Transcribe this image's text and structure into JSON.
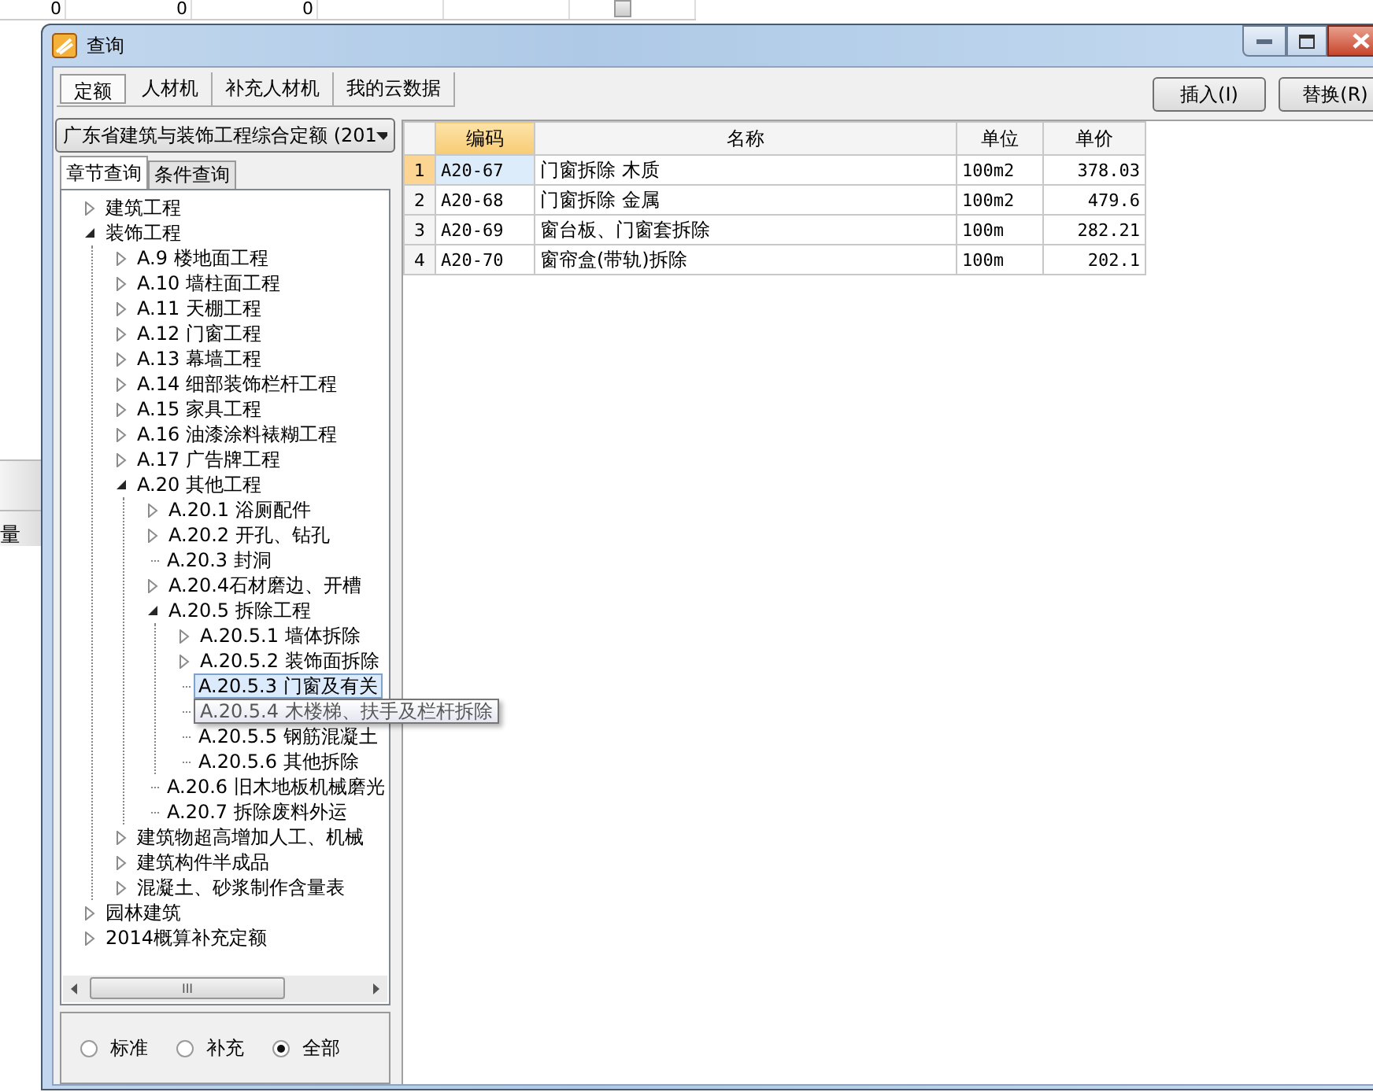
{
  "background_sheet": {
    "row_1": [
      "0",
      "0",
      "0"
    ],
    "checkbox": {
      "checked": false
    },
    "side_cell": "量"
  },
  "window": {
    "title": "查询",
    "tabs": [
      {
        "label": "定额",
        "selected": true
      },
      {
        "label": "人材机",
        "selected": false
      },
      {
        "label": "补充人材机",
        "selected": false
      },
      {
        "label": "我的云数据",
        "selected": false
      }
    ],
    "buttons": [
      "插入(I)",
      "替换(R)"
    ]
  },
  "left_panel": {
    "library_select": "广东省建筑与装饰工程综合定额 (201",
    "tabs": [
      {
        "label": "章节查询",
        "selected": true
      },
      {
        "label": "条件查询",
        "selected": false
      }
    ],
    "tree": [
      {
        "label": "建筑工程",
        "expanded": false,
        "selected": false
      },
      {
        "label": "装饰工程",
        "expanded": true,
        "selected": false,
        "children": [
          {
            "label": "A.9 楼地面工程",
            "expanded": false,
            "selected": false
          },
          {
            "label": "A.10 墙柱面工程",
            "expanded": false,
            "selected": false
          },
          {
            "label": "A.11 天棚工程",
            "expanded": false,
            "selected": false
          },
          {
            "label": "A.12 门窗工程",
            "expanded": false,
            "selected": false
          },
          {
            "label": "A.13 幕墙工程",
            "expanded": false,
            "selected": false
          },
          {
            "label": "A.14 细部装饰栏杆工程",
            "expanded": false,
            "selected": false
          },
          {
            "label": "A.15 家具工程",
            "expanded": false,
            "selected": false
          },
          {
            "label": "A.16 油漆涂料裱糊工程",
            "expanded": false,
            "selected": false
          },
          {
            "label": "A.17 广告牌工程",
            "expanded": false,
            "selected": false
          },
          {
            "label": "A.20 其他工程",
            "expanded": true,
            "selected": false,
            "children": [
              {
                "label": "A.20.1 浴厕配件",
                "expanded": false,
                "selected": false
              },
              {
                "label": "A.20.2 开孔、钻孔",
                "expanded": false,
                "selected": false
              },
              {
                "label": "A.20.3 封洞",
                "selected": false
              },
              {
                "label": "A.20.4石材磨边、开槽",
                "expanded": false,
                "selected": false
              },
              {
                "label": "A.20.5 拆除工程",
                "expanded": true,
                "selected": false,
                "children": [
                  {
                    "label": "A.20.5.1 墙体拆除",
                    "expanded": false,
                    "selected": false
                  },
                  {
                    "label": "A.20.5.2 装饰面拆除",
                    "expanded": false,
                    "selected": false
                  },
                  {
                    "label": "A.20.5.3 门窗及有关",
                    "selected": true
                  },
                  {
                    "label": "A.20.5.4 木楼梯、扶手及栏杆拆除",
                    "selected": false,
                    "hovered": true
                  },
                  {
                    "label": "A.20.5.5 钢筋混凝土",
                    "selected": false
                  },
                  {
                    "label": "A.20.5.6 其他拆除",
                    "selected": false
                  }
                ]
              },
              {
                "label": "A.20.6 旧木地板机械磨光",
                "selected": false
              },
              {
                "label": "A.20.7 拆除废料外运",
                "selected": false
              }
            ]
          },
          {
            "label": "建筑物超高增加人工、机械",
            "expanded": false,
            "selected": false
          },
          {
            "label": "建筑构件半成品",
            "expanded": false,
            "selected": false
          },
          {
            "label": "混凝土、砂浆制作含量表",
            "expanded": false,
            "selected": false
          }
        ]
      },
      {
        "label": "园林建筑",
        "expanded": false,
        "selected": false
      },
      {
        "label": "2014概算补充定额",
        "expanded": false,
        "selected": false
      }
    ],
    "scrollbar_grip": "III",
    "filter_options": [
      {
        "label": "标准",
        "selected": false
      },
      {
        "label": "补充",
        "selected": false
      },
      {
        "label": "全部",
        "selected": true
      }
    ]
  },
  "table": {
    "columns": [
      {
        "label": "编码",
        "active": true
      },
      {
        "label": "名称",
        "active": false
      },
      {
        "label": "单位",
        "active": false
      },
      {
        "label": "单价",
        "active": false
      }
    ],
    "rows": [
      {
        "index": "1",
        "code": "A20-67",
        "name": "门窗拆除 木质",
        "unit": "100m2",
        "price": "378.03",
        "selected": true
      },
      {
        "index": "2",
        "code": "A20-68",
        "name": "门窗拆除 金属",
        "unit": "100m2",
        "price": "479.6",
        "selected": false
      },
      {
        "index": "3",
        "code": "A20-69",
        "name": "窗台板、门窗套拆除",
        "unit": "100m",
        "price": "282.21",
        "selected": false
      },
      {
        "index": "4",
        "code": "A20-70",
        "name": "窗帘盒(带轨)拆除",
        "unit": "100m",
        "price": "202.1",
        "selected": false
      }
    ]
  }
}
